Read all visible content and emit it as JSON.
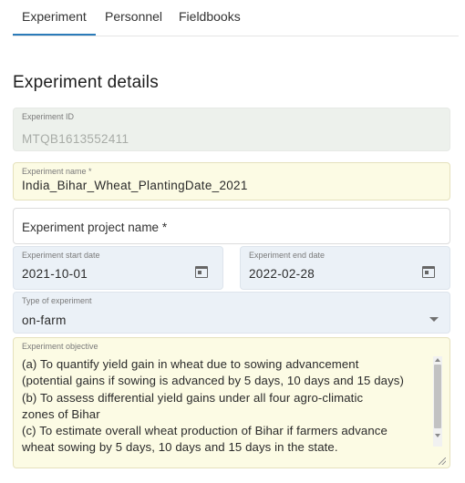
{
  "tabs": [
    {
      "label": "Experiment",
      "active": true
    },
    {
      "label": "Personnel",
      "active": false
    },
    {
      "label": "Fieldbooks",
      "active": false
    }
  ],
  "accent_color": "#2b7bb9",
  "section_title": "Experiment details",
  "fields": {
    "experiment_id": {
      "label": "Experiment ID",
      "value": "MTQB1613552411",
      "disabled": true
    },
    "experiment_name": {
      "label": "Experiment name *",
      "value": "India_Bihar_Wheat_PlantingDate_2021"
    },
    "experiment_project_name": {
      "placeholder": "Experiment project name *",
      "value": ""
    },
    "start_date": {
      "label": "Experiment start date",
      "value": "2021-10-01",
      "icon": "calendar-icon"
    },
    "end_date": {
      "label": "Experiment end date",
      "value": "2022-02-28",
      "icon": "calendar-icon"
    },
    "type": {
      "label": "Type of experiment",
      "value": "on-farm",
      "icon": "chevron-down-icon"
    },
    "objective": {
      "label": "Experiment objective",
      "lines": [
        "(a) To quantify yield gain in wheat due to sowing advancement",
        "(potential gains if sowing is advanced by 5 days, 10 days and 15 days)",
        "(b) To assess differential yield gains under all four agro-climatic",
        "zones of Bihar",
        "(c) To estimate overall wheat production of Bihar if farmers advance",
        "wheat sowing by 5 days, 10 days and 15 days in the state."
      ]
    }
  }
}
